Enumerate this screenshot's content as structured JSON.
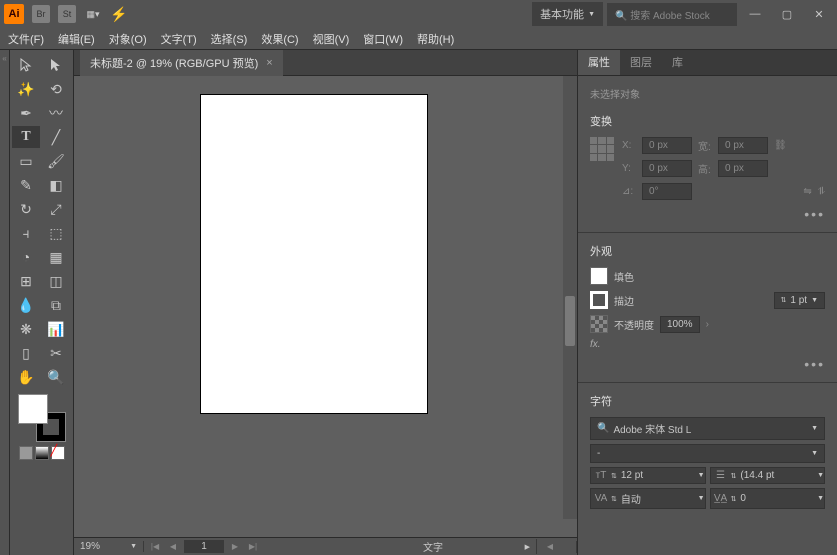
{
  "titlebar": {
    "logo": "Ai",
    "workspace": "基本功能",
    "search_placeholder": "搜索 Adobe Stock"
  },
  "menu": [
    "文件(F)",
    "编辑(E)",
    "对象(O)",
    "文字(T)",
    "选择(S)",
    "效果(C)",
    "视图(V)",
    "窗口(W)",
    "帮助(H)"
  ],
  "document": {
    "tab_title": "未标题-2 @ 19% (RGB/GPU 预览)"
  },
  "status": {
    "zoom": "19%",
    "page": "1",
    "context": "文字"
  },
  "panels": {
    "tabs": [
      "属性",
      "图层",
      "库"
    ],
    "no_selection": "未选择对象",
    "transform": {
      "header": "变换",
      "x_label": "X:",
      "x_val": "0 px",
      "y_label": "Y:",
      "y_val": "0 px",
      "w_label": "宽:",
      "w_val": "0 px",
      "h_label": "高:",
      "h_val": "0 px",
      "angle_label": "⊿:",
      "angle_val": "0°"
    },
    "appearance": {
      "header": "外观",
      "fill": "填色",
      "stroke": "描边",
      "stroke_val": "1 pt",
      "opacity": "不透明度",
      "opacity_val": "100%",
      "fx": "fx."
    },
    "character": {
      "header": "字符",
      "font": "Adobe 宋体 Std L",
      "style": "-",
      "size": "12 pt",
      "leading": "(14.4 pt",
      "kerning": "自动",
      "tracking": "0"
    }
  }
}
